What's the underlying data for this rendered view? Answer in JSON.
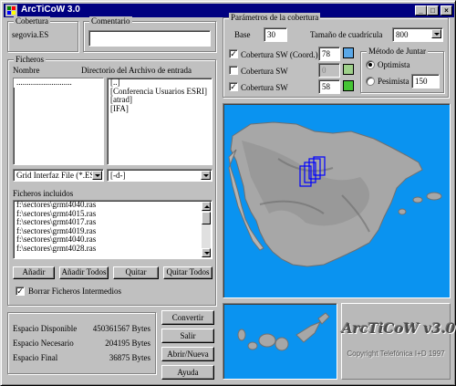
{
  "window": {
    "title": "ArcTiCoW 3.0",
    "btn_min": "_",
    "btn_max": "□",
    "btn_close": "×"
  },
  "cobertura": {
    "label": "Cobertura",
    "value": "segovia.ES"
  },
  "comentario": {
    "label": "Comentario",
    "value": ""
  },
  "ficheros": {
    "label": "Ficheros",
    "nombre_label": "Nombre",
    "directorio_label": "Directorio del Archivo de entrada",
    "files": [
      "..........................."
    ],
    "dirs": [
      "[..]",
      "[Conferencia Usuarios ESRI]",
      "[atrad]",
      "[IFA]"
    ],
    "type_select": "Grid Interfaz File (*.ES)",
    "drive_select": "[-d-]",
    "incluidos_label": "Ficheros incluidos",
    "incluidos": [
      "f:\\sectores\\grmt4040.ras",
      "f:\\sectores\\grmt4015.ras",
      "f:\\sectores\\grmt4017.ras",
      "f:\\sectores\\grmt4019.ras",
      "f:\\sectores\\grmt4040.ras",
      "f:\\sectores\\grmt4028.ras"
    ],
    "btn_anadir": "Añadir",
    "btn_anadir_todos": "Añadir Todos",
    "btn_quitar": "Quitar",
    "btn_quitar_todos": "Quitar Todos",
    "borrar_label": "Borrar Ficheros Intermedios",
    "borrar_checked": true
  },
  "parametros": {
    "label": "Parámetros de la cobertura",
    "base_label": "Base",
    "base_value": "30",
    "tamano_label": "Tamaño de cuadrícula",
    "tamano_value": "800",
    "cob1_label": "Cobertura SW (Coord.)",
    "cob1_value": "78",
    "cob1_checked": true,
    "cob2_label": "Cobertura SW",
    "cob2_value": "0",
    "cob2_checked": false,
    "cob3_label": "Cobertura SW",
    "cob3_value": "58",
    "cob3_checked": true,
    "metodo_label": "Método de Juntar",
    "optimista_label": "Optimista",
    "pesimista_label": "Pesimista",
    "pesimista_value": "150",
    "optimista_selected": true
  },
  "stats": {
    "disponible_label": "Espacio Disponible",
    "disponible_value": "450361567 Bytes",
    "necesario_label": "Espacio Necesario",
    "necesario_value": "204195 Bytes",
    "final_label": "Espacio Final",
    "final_value": "36875 Bytes"
  },
  "actions": {
    "convertir": "Convertir",
    "salir": "Salir",
    "abrir": "Abrir/Nueva",
    "ayuda": "Ayuda"
  },
  "logo": {
    "title": "ArcTiCoW v3.0",
    "copyright": "Copyright Telefónica I+D 1997"
  },
  "colors": {
    "title_bg": "#000080",
    "map_bg": "#0a93f0",
    "selection": "#0000ff"
  }
}
